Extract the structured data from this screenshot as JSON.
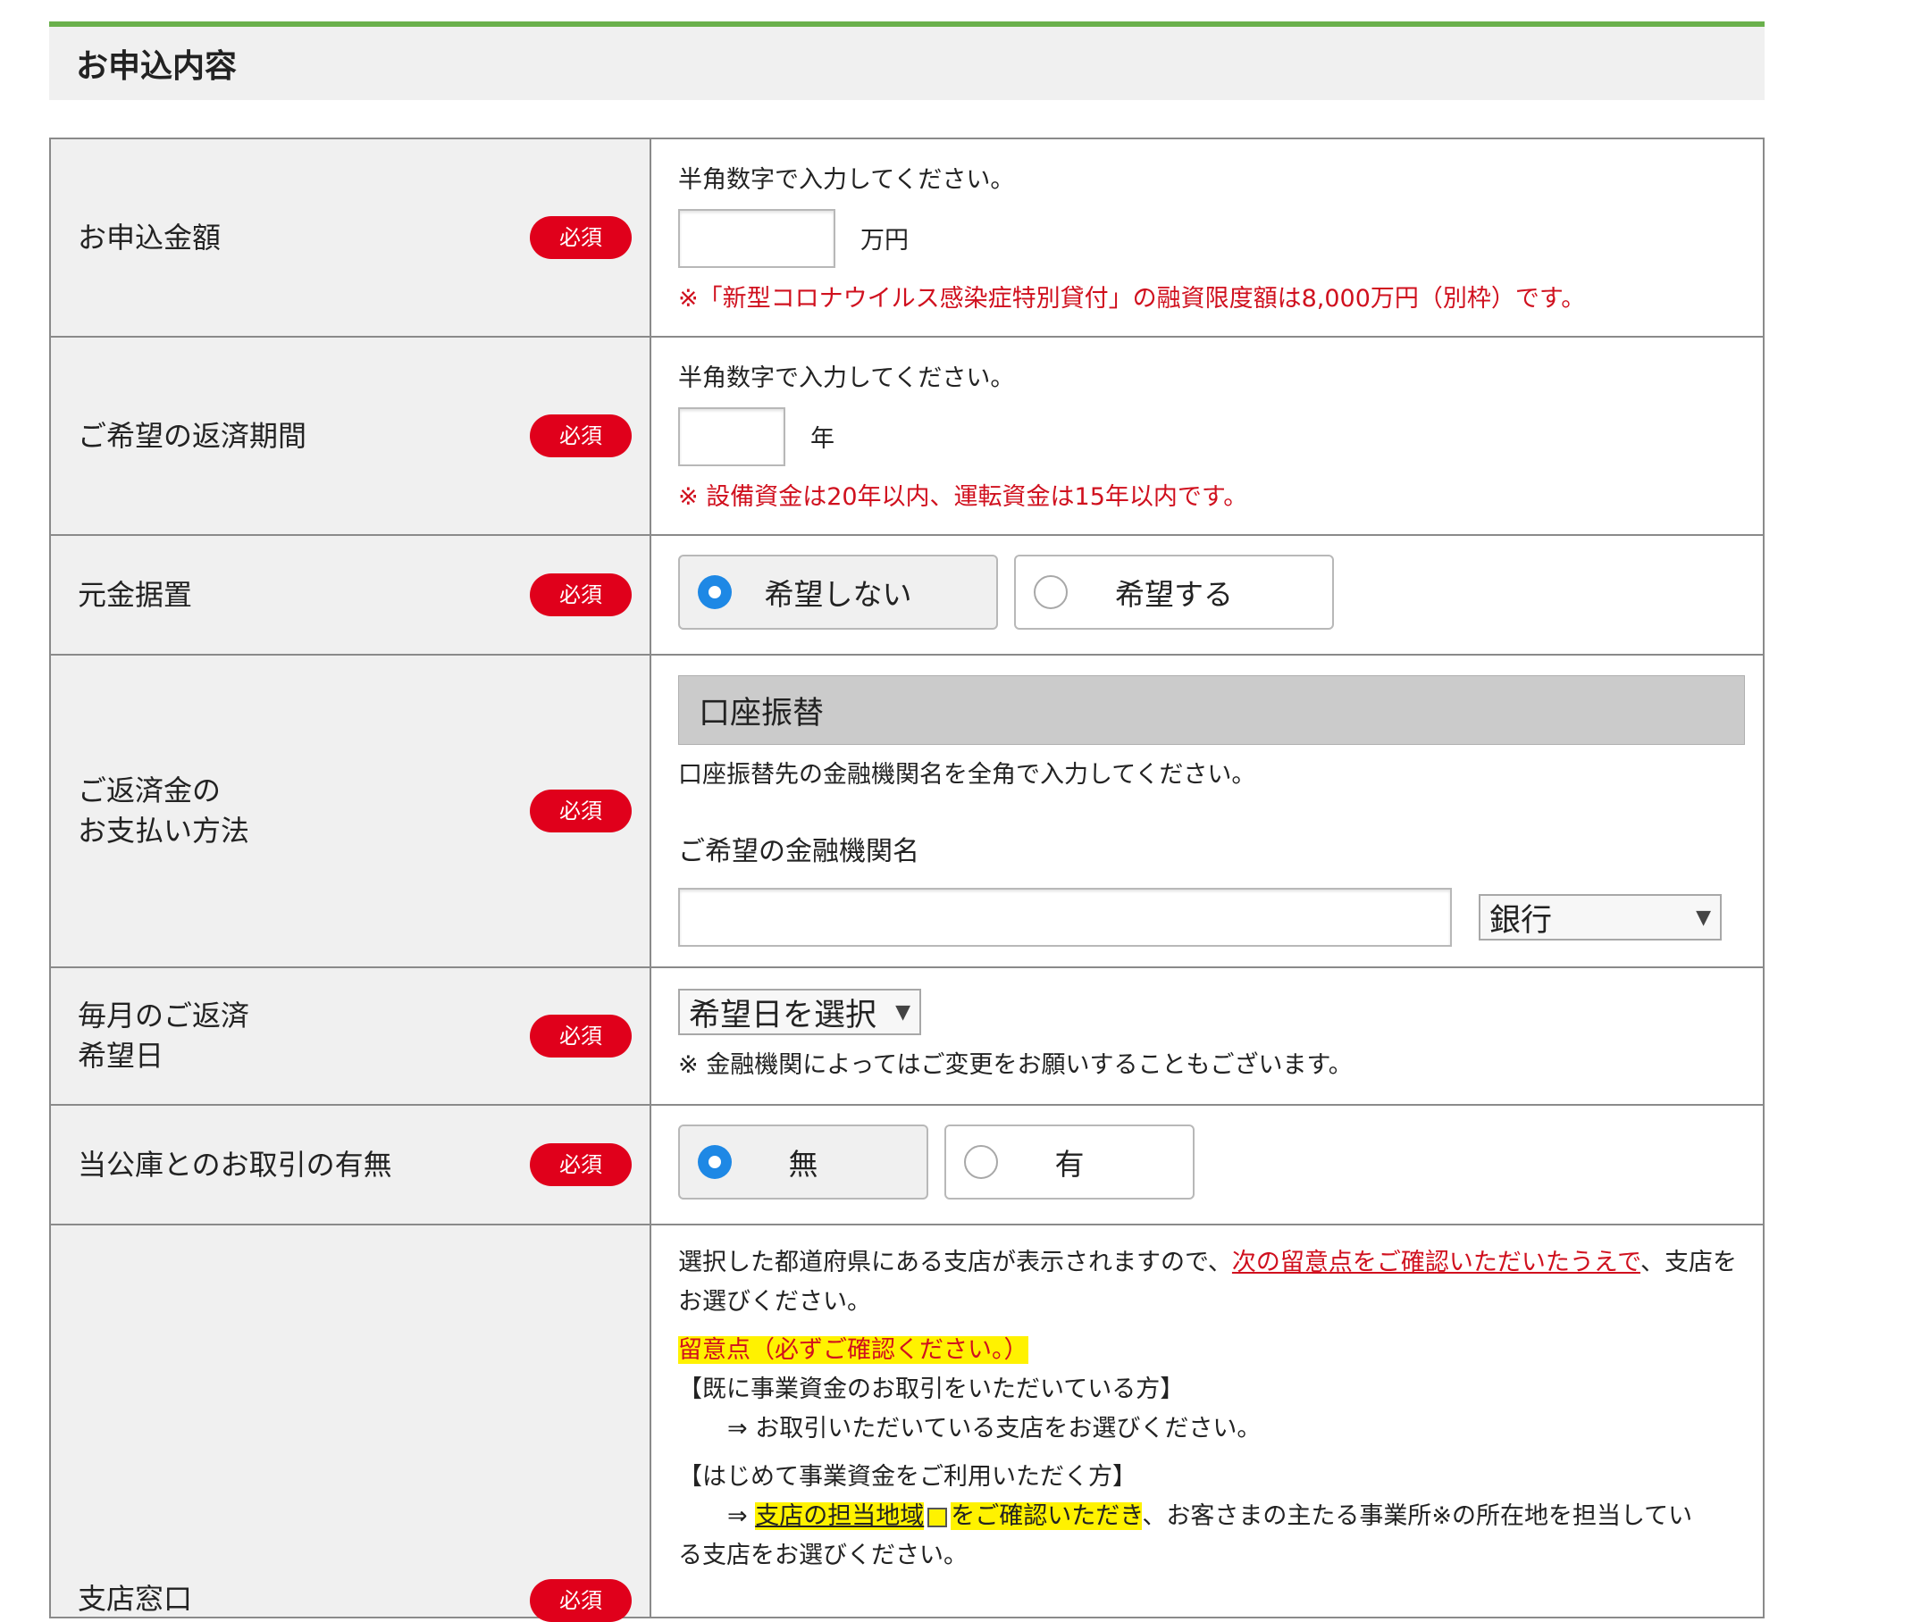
{
  "section": {
    "title": "お申込内容"
  },
  "required_label": "必須",
  "amount": {
    "label": "お申込金額",
    "hint": "半角数字で入力してください。",
    "value": "",
    "unit": "万円",
    "note": "※「新型コロナウイルス感染症特別貸付」の融資限度額は8,000万円（別枠）です。"
  },
  "period": {
    "label": "ご希望の返済期間",
    "hint": "半角数字で入力してください。",
    "value": "",
    "unit": "年",
    "note": "※ 設備資金は20年以内、運転資金は15年以内です。"
  },
  "deferment": {
    "label": "元金据置",
    "options": [
      "希望しない",
      "希望する"
    ],
    "selected": "希望しない"
  },
  "payment": {
    "label_line1": "ご返済金の",
    "label_line2": "お支払い方法",
    "method": "口座振替",
    "hint": "口座振替先の金融機関名を全角で入力してください。",
    "bank_label": "ご希望の金融機関名",
    "bank_value": "",
    "bank_type": "銀行"
  },
  "monthly": {
    "label_line1": "毎月のご返済",
    "label_line2": "希望日",
    "select_text": "希望日を選択",
    "note": "※ 金融機関によってはご変更をお願いすることもございます。"
  },
  "transaction": {
    "label": "当公庫とのお取引の有無",
    "options": [
      "無",
      "有"
    ],
    "selected": "無"
  },
  "branch": {
    "label": "支店窓口",
    "intro_pre": "選択した都道府県にある支店が表示されますので、",
    "intro_link": "次の留意点をご確認いただいたうえで",
    "intro_post": "、支店を",
    "intro_line2": "お選びください。",
    "caution_title": "留意点（必ずご確認ください。）",
    "existing_heading": "【既に事業資金のお取引をいただいている方】",
    "existing_text": "⇒ お取引いただいている支店をお選びください。",
    "first_heading": "【はじめて事業資金をご利用いただく方】",
    "first_arrow": "⇒",
    "first_link": "支店の担当地域",
    "first_hl": "をご確認いただき",
    "first_text": "、お客さまの主たる事業所※の所在地を担当してい",
    "first_line2": "る支店をお選びください。"
  }
}
